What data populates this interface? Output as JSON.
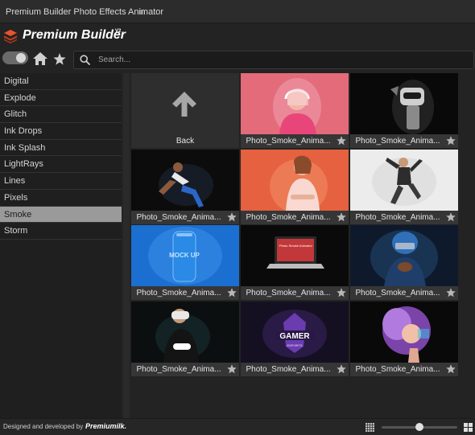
{
  "window": {
    "title": "Premium Builder Photo Effects Animator",
    "menu_glyph": "≡"
  },
  "brand": {
    "name": "Premium Builder",
    "version": "V2",
    "logo_color": "#e8532b"
  },
  "toolbar": {
    "toggle_on": true,
    "icons": [
      "home-icon",
      "star-icon"
    ]
  },
  "search": {
    "placeholder": "Search...",
    "value": ""
  },
  "sidebar": {
    "active_index": 8,
    "items": [
      {
        "label": "Digital"
      },
      {
        "label": "Explode"
      },
      {
        "label": "Glitch"
      },
      {
        "label": "Ink Drops"
      },
      {
        "label": "Ink Splash"
      },
      {
        "label": "LightRays"
      },
      {
        "label": "Lines"
      },
      {
        "label": "Pixels"
      },
      {
        "label": "Smoke"
      },
      {
        "label": "Storm"
      }
    ]
  },
  "grid": {
    "back": {
      "label": "Back"
    },
    "tiles": [
      {
        "label": "Photo_Smoke_Anima...",
        "thumb": "woman-pink-headphones"
      },
      {
        "label": "Photo_Smoke_Anima...",
        "thumb": "robot-dark"
      },
      {
        "label": "Photo_Smoke_Anima...",
        "thumb": "sprinter-dark"
      },
      {
        "label": "Photo_Smoke_Anima...",
        "thumb": "woman-orange-fitness"
      },
      {
        "label": "Photo_Smoke_Anima...",
        "thumb": "man-jumping-white"
      },
      {
        "label": "Photo_Smoke_Anima...",
        "thumb": "can-mockup-blue"
      },
      {
        "label": "Photo_Smoke_Anima...",
        "thumb": "laptop-mockup-dark"
      },
      {
        "label": "Photo_Smoke_Anima...",
        "thumb": "football-player-blue"
      },
      {
        "label": "Photo_Smoke_Anima...",
        "thumb": "vr-headset-gamer"
      },
      {
        "label": "Photo_Smoke_Anima...",
        "thumb": "gamer-esports-logo"
      },
      {
        "label": "Photo_Smoke_Anima...",
        "thumb": "woman-purple-hair"
      }
    ],
    "thumb_texts": {
      "can": "MOCK UP",
      "laptop": "Photo Smoke Animator",
      "gamer": "GAMER",
      "esports": "ESPORTS"
    }
  },
  "footer": {
    "credit": "Designed and developed by",
    "credit_brand": "Premiumilk.",
    "zoom_fraction": 0.5
  }
}
